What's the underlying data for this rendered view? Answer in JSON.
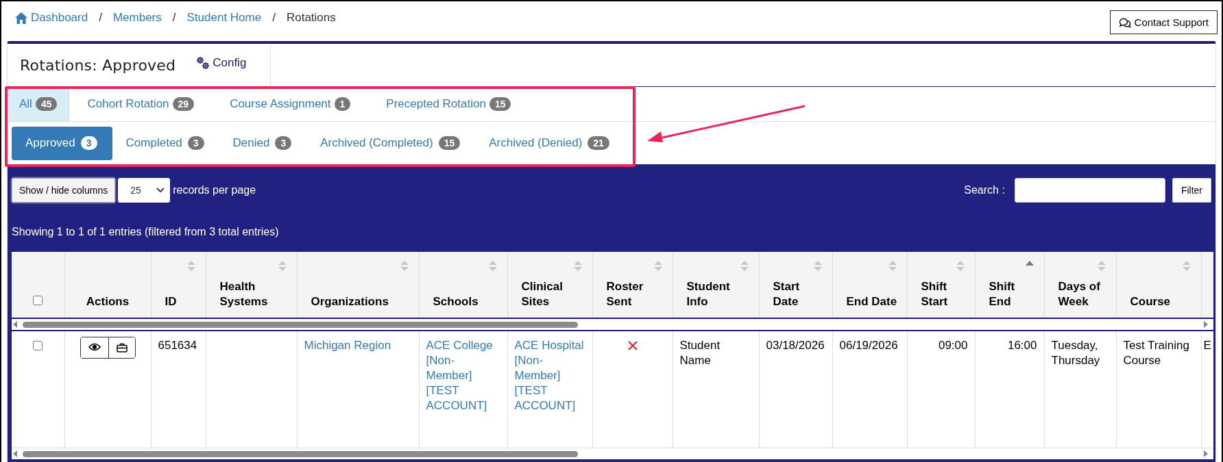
{
  "breadcrumb": {
    "separator": "/",
    "items": [
      {
        "label": "Dashboard",
        "kind": "home"
      },
      {
        "label": "Members",
        "kind": "link"
      },
      {
        "label": "Student Home",
        "kind": "link"
      },
      {
        "label": "Rotations",
        "kind": "current"
      }
    ]
  },
  "contact_button": "Contact Support",
  "panel": {
    "title": "Rotations: Approved",
    "config_button": "Config"
  },
  "type_tabs": [
    {
      "label": "All",
      "count": "45",
      "selected": true
    },
    {
      "label": "Cohort Rotation",
      "count": "29",
      "selected": false
    },
    {
      "label": "Course Assignment",
      "count": "1",
      "selected": false
    },
    {
      "label": "Precepted Rotation",
      "count": "15",
      "selected": false
    }
  ],
  "status_tabs": [
    {
      "label": "Approved",
      "count": "3",
      "selected": true
    },
    {
      "label": "Completed",
      "count": "3",
      "selected": false
    },
    {
      "label": "Denied",
      "count": "3",
      "selected": false
    },
    {
      "label": "Archived (Completed)",
      "count": "15",
      "selected": false
    },
    {
      "label": "Archived (Denied)",
      "count": "21",
      "selected": false
    }
  ],
  "toolbar": {
    "columns_button": "Show / hide columns",
    "page_size": "25",
    "page_size_suffix": "records per page",
    "search_label": "Search :",
    "filter_button": "Filter"
  },
  "info": "Showing 1 to 1 of 1 entries (filtered from 3 total entries)",
  "table": {
    "columns": [
      {
        "kind": "select",
        "checked": false
      },
      {
        "kind": "plain",
        "label": "Actions"
      },
      {
        "kind": "sortable",
        "label": "ID",
        "sorted": false
      },
      {
        "kind": "sortable",
        "label": "Health Systems",
        "sorted": false
      },
      {
        "kind": "sortable",
        "label": "Organizations",
        "sorted": false
      },
      {
        "kind": "sortable",
        "label": "Schools",
        "sorted": false
      },
      {
        "kind": "sortable",
        "label": "Clinical Sites",
        "sorted": false
      },
      {
        "kind": "sortable",
        "label": "Roster Sent",
        "sorted": false
      },
      {
        "kind": "sortable",
        "label": "Student Info",
        "sorted": false
      },
      {
        "kind": "sortable",
        "label": "Start Date",
        "sorted": false
      },
      {
        "kind": "sortable",
        "label": "End Date",
        "sorted": false
      },
      {
        "kind": "sortable",
        "label": "Shift Start",
        "sorted": false
      },
      {
        "kind": "sortable",
        "label": "Shift End",
        "sorted": true
      },
      {
        "kind": "sortable",
        "label": "Days of Week",
        "sorted": false
      },
      {
        "kind": "sortable",
        "label": "Course",
        "sorted": false
      },
      {
        "kind": "blank"
      }
    ],
    "rows": [
      {
        "checked": false,
        "cells": [
          {
            "kind": "select"
          },
          {
            "kind": "actions"
          },
          {
            "kind": "text",
            "text": "651634"
          },
          {
            "kind": "empty"
          },
          {
            "kind": "link",
            "text": "Michigan Region"
          },
          {
            "kind": "link",
            "text": "ACE College [Non-Member] [TEST ACCOUNT]"
          },
          {
            "kind": "link",
            "text": "ACE Hospital [Non-Member] [TEST ACCOUNT]"
          },
          {
            "kind": "flag",
            "on": false
          },
          {
            "kind": "text",
            "text": "Student Name"
          },
          {
            "kind": "text",
            "text": "03/18/2026"
          },
          {
            "kind": "text",
            "text": "06/19/2026"
          },
          {
            "kind": "number",
            "text": "09:00"
          },
          {
            "kind": "number",
            "text": "16:00"
          },
          {
            "kind": "text",
            "text": "Tuesday, Thursday"
          },
          {
            "kind": "text",
            "text": "Test Training Course"
          },
          {
            "kind": "text",
            "text": "E"
          }
        ]
      }
    ]
  },
  "annotations": {
    "highlight_box": true,
    "arrow": true
  }
}
